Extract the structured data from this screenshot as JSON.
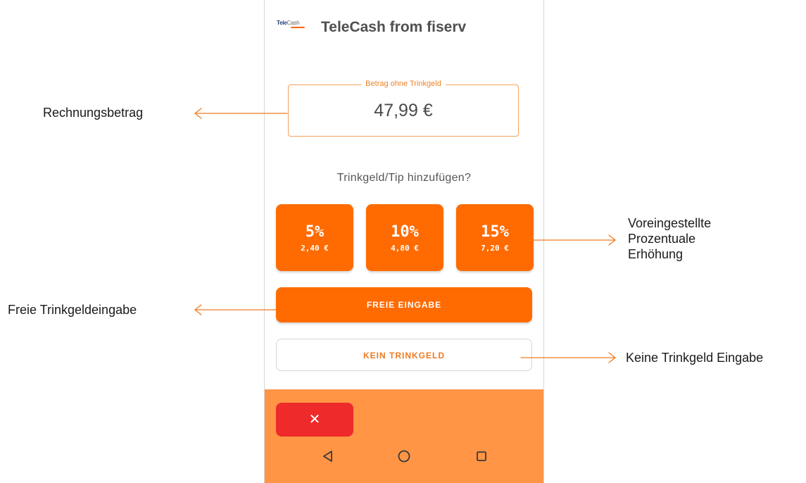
{
  "header": {
    "logo_text_1": "Tele",
    "logo_text_2": "Cash",
    "title": "TeleCash from fiserv"
  },
  "amount": {
    "legend": "Betrag ohne Trinkgeld",
    "value": "47,99 €"
  },
  "question": "Trinkgeld/Tip hinzufügen?",
  "tip_options": [
    {
      "percent": "5%",
      "amount": "2,40 €"
    },
    {
      "percent": "10%",
      "amount": "4,80 €"
    },
    {
      "percent": "15%",
      "amount": "7,20 €"
    }
  ],
  "free_entry_label": "FREIE EINGABE",
  "no_tip_label": "KEIN TRINKGELD",
  "cancel_symbol": "✕",
  "annotations": {
    "rechnungsbetrag": "Rechnungsbetrag",
    "freie": "Freie Trinkgeldeingabe",
    "voreingestellt_line1": "Voreingestellte",
    "voreingestellt_line2": "Prozentuale",
    "voreingestellt_line3": "Erhöhung",
    "keine": "Keine Trinkgeld Eingabe"
  },
  "colors": {
    "accent": "#ff6b00",
    "bottom_bar": "#ff9545",
    "cancel": "#ee2a2a",
    "arrow": "#f07a20"
  },
  "icons": {
    "nav_back": "triangle-back-icon",
    "nav_home": "circle-home-icon",
    "nav_recent": "square-recent-icon"
  }
}
